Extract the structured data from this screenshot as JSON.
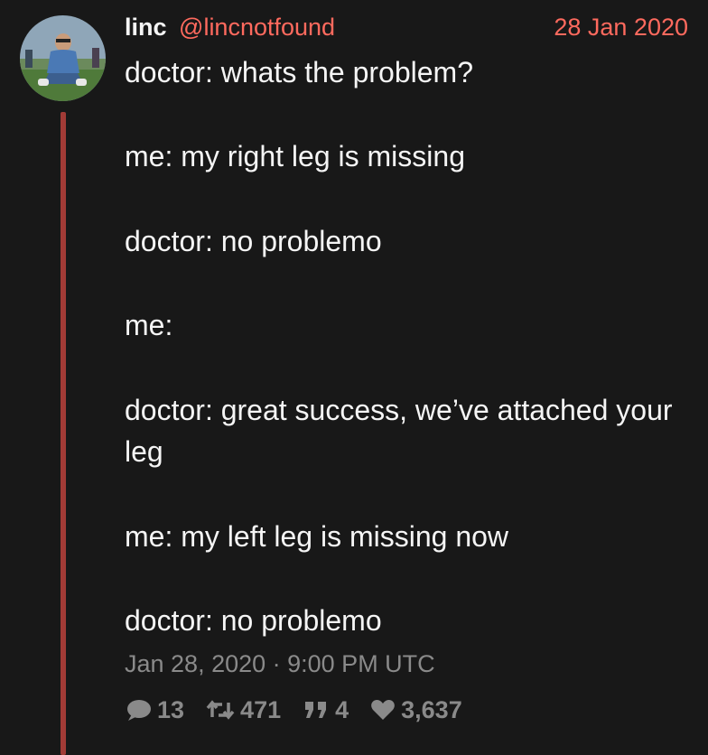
{
  "tweet": {
    "fullname": "linc",
    "username": "@lincnotfound",
    "date": "28 Jan 2020",
    "content": [
      "doctor: whats the problem?",
      "me: my right leg is missing",
      "doctor: no problemo",
      "me:",
      "doctor: great success, we’ve attached your leg",
      "me: my left leg is missing now",
      "doctor: no problemo"
    ],
    "published": "Jan 28, 2020 · 9:00 PM UTC",
    "stats": {
      "replies": "13",
      "retweets": "471",
      "quotes": "4",
      "likes": "3,637"
    }
  },
  "icons": [
    "avatar",
    "comment-icon",
    "retweet-icon",
    "quote-icon",
    "heart-icon"
  ],
  "colors": {
    "background": "#181818",
    "accent": "#ff6a5e",
    "thread_line": "#a23b36",
    "muted": "#8a8a8a",
    "text": "#f5f5f5"
  }
}
